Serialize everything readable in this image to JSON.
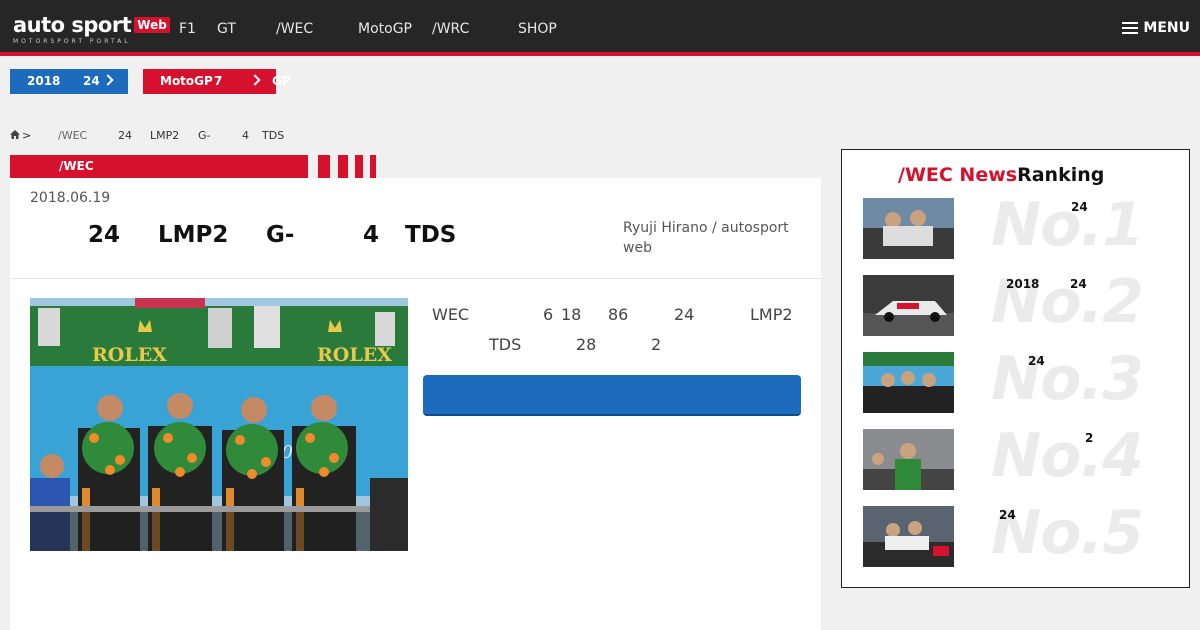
{
  "header": {
    "logo_text": "auto sport",
    "logo_badge": "Web",
    "logo_subtitle": "MOTORSPORT PORTAL",
    "nav": [
      "F1",
      "GT",
      "/WEC",
      "MotoGP",
      "/WRC",
      "SHOP"
    ],
    "menu_label": "MENU"
  },
  "promos": {
    "blue": {
      "left": "2018",
      "right": "24"
    },
    "red": {
      "left": "MotoGP",
      "right": "7"
    },
    "overflow": "GP"
  },
  "breadcrumb": {
    "sep": ">",
    "items": [
      "/WEC",
      "24",
      "LMP2",
      "G-",
      "4",
      "TDS"
    ]
  },
  "category": {
    "label": "/WEC"
  },
  "article": {
    "date": "2018.06.19",
    "title_parts": [
      "24",
      "LMP2",
      "G-",
      "4",
      "TDS"
    ],
    "byline": "Ryuji Hirano / autosport web",
    "lead_line1": [
      "WEC",
      "6",
      "18",
      "86",
      "24",
      "LMP2"
    ],
    "lead_line2": [
      "TDS",
      "28",
      "2"
    ],
    "photo_banner_left": "ROLEX",
    "photo_banner_right": "ROLEX"
  },
  "sidebar": {
    "title_red": "/WEC News",
    "title_black": "Ranking",
    "items": [
      {
        "rank": "No.1",
        "texts": [
          "24"
        ]
      },
      {
        "rank": "No.2",
        "texts": [
          "2018",
          "24"
        ]
      },
      {
        "rank": "No.3",
        "texts": [
          "24"
        ]
      },
      {
        "rank": "No.4",
        "texts": [
          "2"
        ]
      },
      {
        "rank": "No.5",
        "texts": [
          "24"
        ]
      }
    ]
  },
  "colors": {
    "accent_red": "#d6112e",
    "accent_blue": "#1c6bbd",
    "header_bg": "#262626"
  }
}
